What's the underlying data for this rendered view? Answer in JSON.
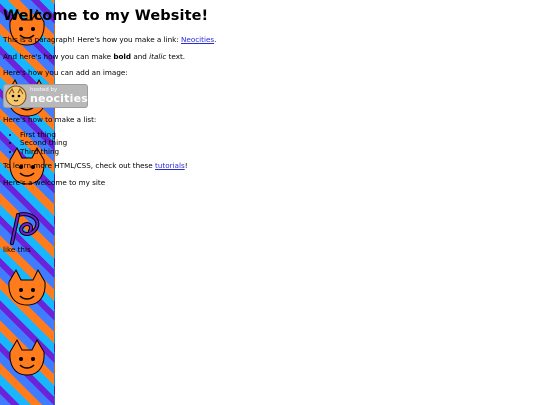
{
  "page": {
    "title": "Welcome to my Website!",
    "paragraph_link": {
      "before": "This is a paragraph! Here's how you make a link: ",
      "link_text": "Neocities",
      "after": "."
    },
    "paragraph_bold_italic": {
      "before": "And here's how you can make ",
      "bold": "bold",
      "middle": " and ",
      "italic": "italic",
      "after": " text."
    },
    "paragraph_image": "Here's how you can add an image:",
    "badge": {
      "hosted_by": "hosted by",
      "brand": "neocities",
      "icon": "neocities-cat-logo-icon"
    },
    "paragraph_list": "Here's how to make a list:",
    "list_items": [
      "First thing",
      "Second thing",
      "Third thing"
    ],
    "paragraph_tutorials": {
      "before": "To learn more HTML/CSS, check out these ",
      "link_text": "tutorials",
      "after": "!"
    },
    "paragraph_welcome": "Here's a welcome to my site",
    "paragraph_like": "like this"
  },
  "colors": {
    "link": "#2b2bd6",
    "badge_bg": "#b9b9b9",
    "pattern_blue": "#3f7cff",
    "pattern_purple": "#6c22d8",
    "pattern_cyan": "#18b6ff",
    "pattern_orange": "#ff7b1c"
  }
}
